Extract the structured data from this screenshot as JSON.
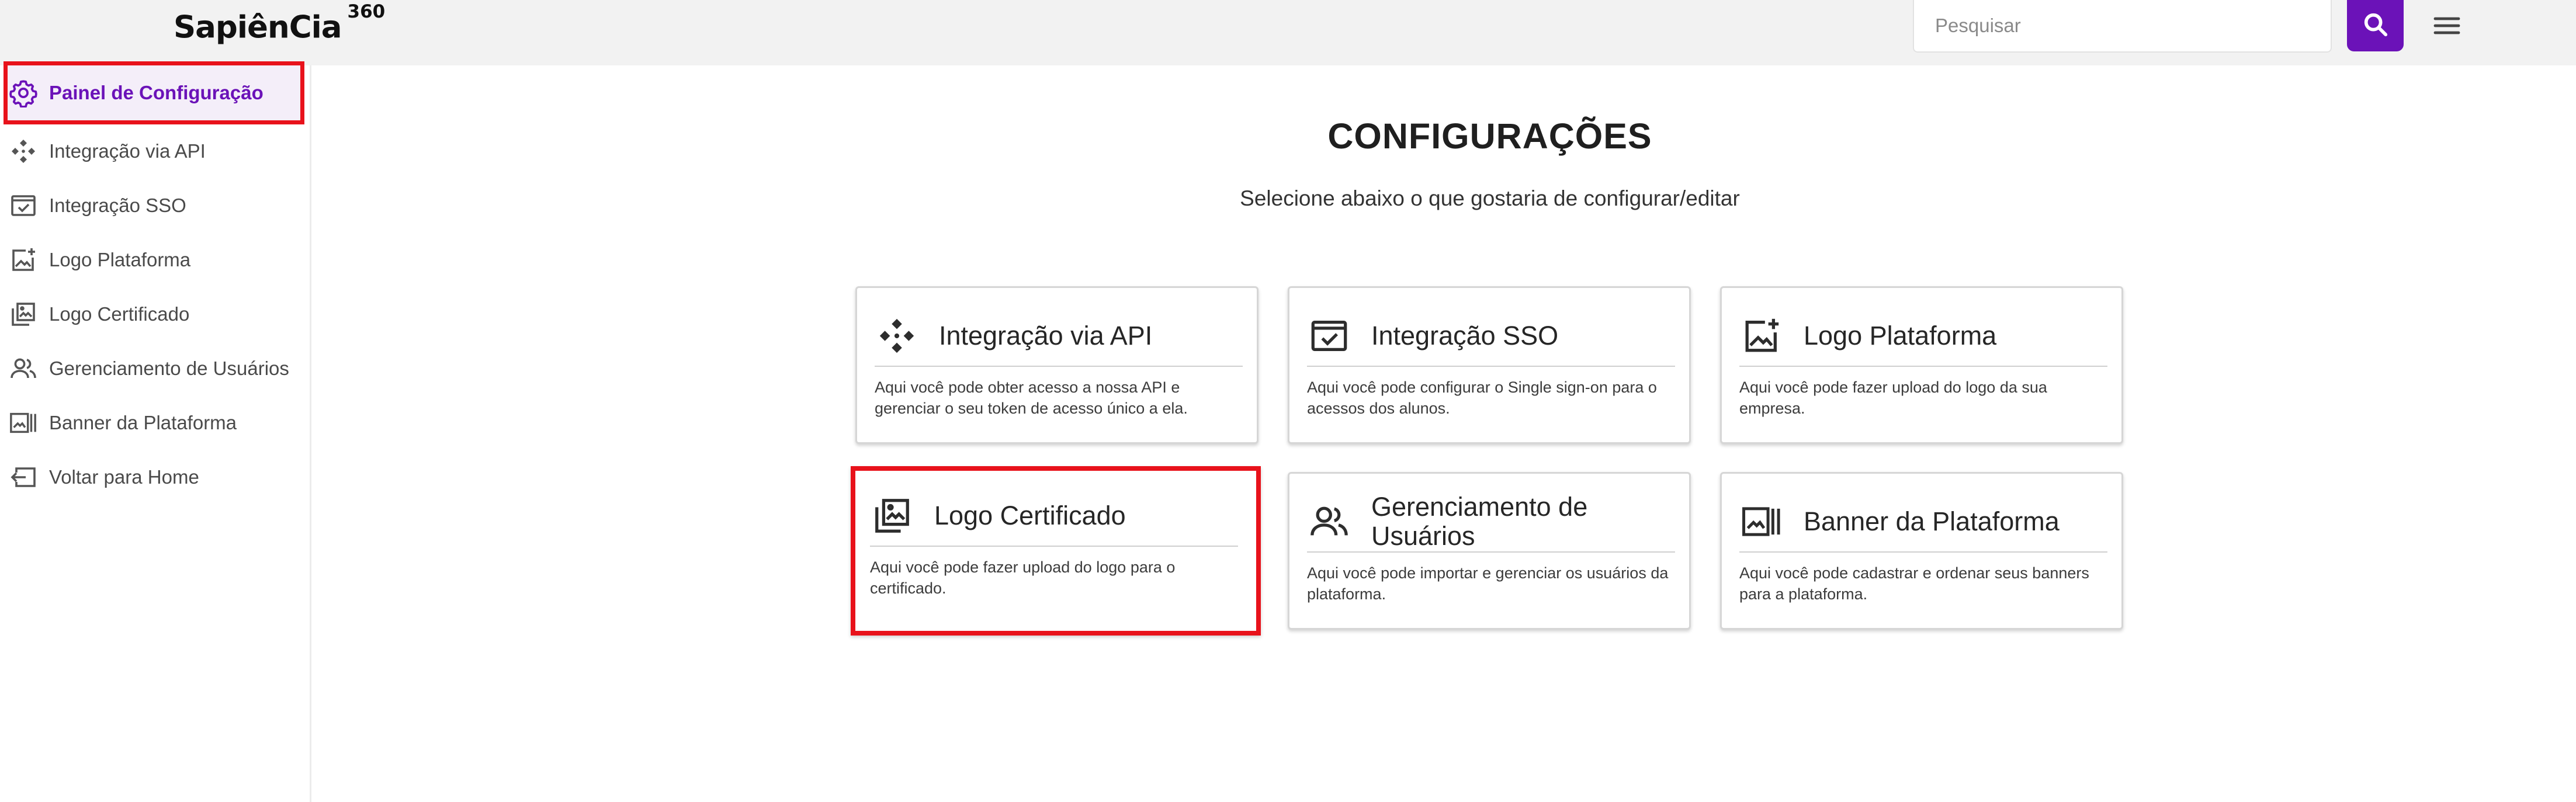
{
  "app": {
    "brand_name": "SapiênCia",
    "brand_suffix": "360",
    "accent_color": "#6b12b8",
    "highlight_color": "#e8121b"
  },
  "topbar": {
    "search_placeholder": "Pesquisar",
    "search_button_icon": "search-icon",
    "menu_icon": "hamburger-menu-icon"
  },
  "sidebar": {
    "items": [
      {
        "label": "Painel de Configuração",
        "icon": "gear-icon",
        "active": true
      },
      {
        "label": "Integração via API",
        "icon": "api-diamond-icon",
        "active": false
      },
      {
        "label": "Integração SSO",
        "icon": "sso-window-check-icon",
        "active": false
      },
      {
        "label": "Logo Plataforma",
        "icon": "add-image-icon",
        "active": false
      },
      {
        "label": "Logo Certificado",
        "icon": "image-gallery-icon",
        "active": false
      },
      {
        "label": "Gerenciamento de Usuários",
        "icon": "users-icon",
        "active": false
      },
      {
        "label": "Banner da Plataforma",
        "icon": "banner-icon",
        "active": false
      },
      {
        "label": "Voltar para Home",
        "icon": "exit-arrow-icon",
        "active": false
      }
    ]
  },
  "main": {
    "title": "CONFIGURAÇÕES",
    "subtitle": "Selecione abaixo o que gostaria de configurar/editar",
    "cards": [
      {
        "title": "Integração via API",
        "description": "Aqui você pode obter acesso a nossa API e gerenciar o seu token de acesso único a ela.",
        "icon": "api-diamond-icon"
      },
      {
        "title": "Integração SSO",
        "description": "Aqui você pode configurar o Single sign-on para o acessos dos alunos.",
        "icon": "sso-window-check-icon"
      },
      {
        "title": "Logo Plataforma",
        "description": "Aqui você pode fazer upload do logo da sua empresa.",
        "icon": "add-image-icon"
      },
      {
        "title": "Logo Certificado",
        "description": "Aqui você pode fazer upload do logo para o certificado.",
        "icon": "image-gallery-icon",
        "highlighted": true
      },
      {
        "title": "Gerenciamento de Usuários",
        "description": "Aqui você pode importar e gerenciar os usuários da plataforma.",
        "icon": "users-icon"
      },
      {
        "title": "Banner da Plataforma",
        "description": "Aqui você pode cadastrar e ordenar seus banners para a plataforma.",
        "icon": "banner-icon"
      }
    ]
  }
}
